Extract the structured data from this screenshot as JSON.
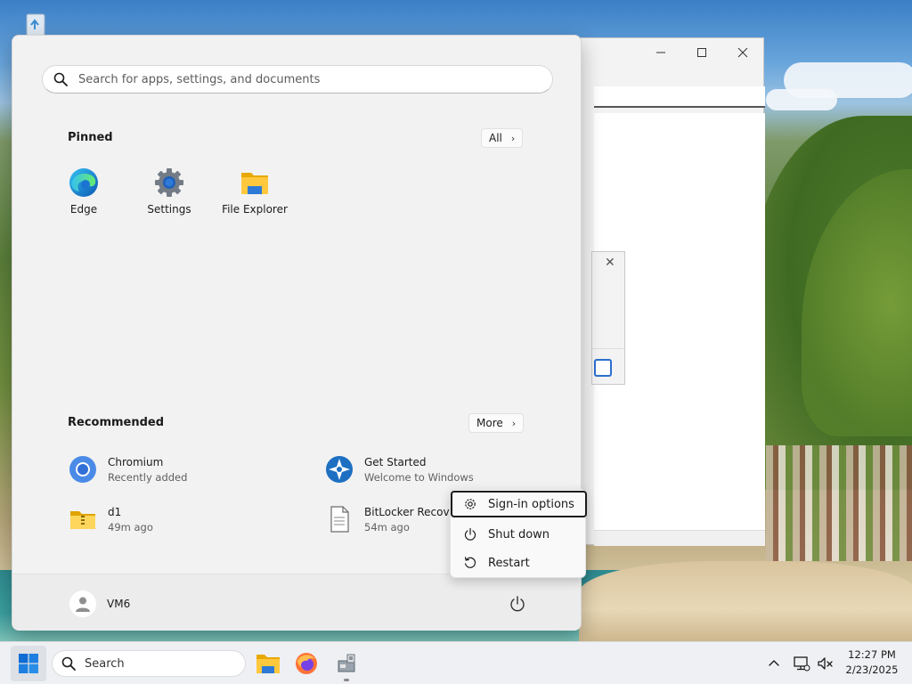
{
  "start_menu": {
    "search_placeholder": "Search for apps, settings, and documents",
    "pinned_title": "Pinned",
    "all_label": "All",
    "pinned_apps": [
      {
        "label": "Edge",
        "icon": "edge-icon"
      },
      {
        "label": "Settings",
        "icon": "gear-icon"
      },
      {
        "label": "File Explorer",
        "icon": "folder-icon"
      }
    ],
    "recommended_title": "Recommended",
    "more_label": "More",
    "recommended": [
      {
        "name": "Chromium",
        "sub": "Recently added",
        "icon": "chromium-icon"
      },
      {
        "name": "Get Started",
        "sub": "Welcome to Windows",
        "icon": "get-started-icon"
      },
      {
        "name": "d1",
        "sub": "49m ago",
        "icon": "zip-folder-icon"
      },
      {
        "name": "BitLocker Recover",
        "sub": "54m ago",
        "icon": "document-icon"
      }
    ],
    "user_name": "VM6"
  },
  "power_menu": {
    "items": [
      "Sign-in options",
      "Shut down",
      "Restart"
    ]
  },
  "taskbar": {
    "search_label": "Search",
    "time": "12:27 PM",
    "date": "2/23/2025"
  },
  "colors": {
    "accent": "#0067c0",
    "start_bg": "#f2f2f2",
    "taskbar_bg": "#eef0f3"
  }
}
